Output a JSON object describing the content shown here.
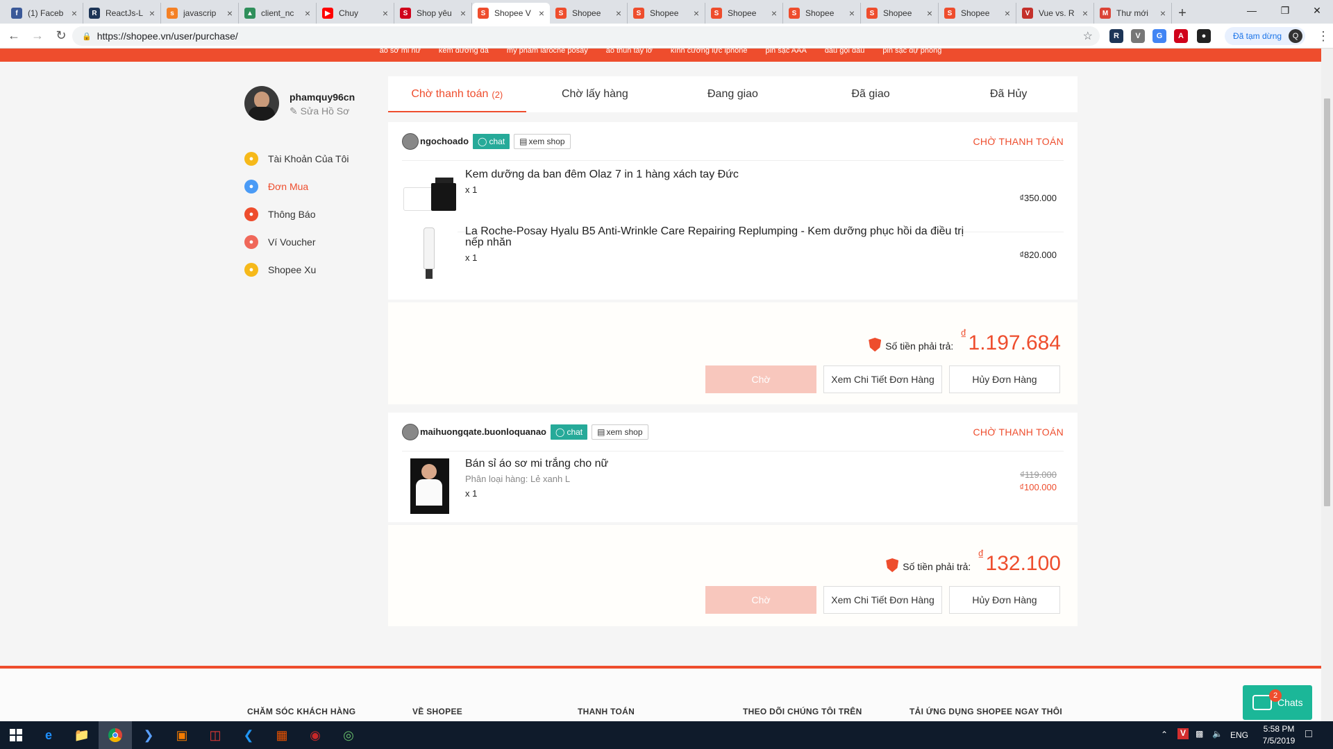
{
  "browser": {
    "tabs": [
      {
        "label": "(1) Faceb",
        "fav": "f",
        "color": "#3b5998"
      },
      {
        "label": "ReactJs-L",
        "fav": "R",
        "color": "#1d3557"
      },
      {
        "label": "javascrip",
        "fav": "s",
        "color": "#f48024"
      },
      {
        "label": "client_nc",
        "fav": "▲",
        "color": "#2f8f5b"
      },
      {
        "label": "Chuy",
        "fav": "▶",
        "color": "#ff0000"
      },
      {
        "label": "Shop yêu",
        "fav": "S",
        "color": "#d0021b"
      },
      {
        "label": "Shopee V",
        "fav": "S",
        "color": "#ee4d2d",
        "active": true
      },
      {
        "label": "Shopee",
        "fav": "S",
        "color": "#ee4d2d"
      },
      {
        "label": "Shopee",
        "fav": "S",
        "color": "#ee4d2d"
      },
      {
        "label": "Shopee",
        "fav": "S",
        "color": "#ee4d2d"
      },
      {
        "label": "Shopee",
        "fav": "S",
        "color": "#ee4d2d"
      },
      {
        "label": "Shopee",
        "fav": "S",
        "color": "#ee4d2d"
      },
      {
        "label": "Shopee",
        "fav": "S",
        "color": "#ee4d2d"
      },
      {
        "label": "Vue vs. R",
        "fav": "V",
        "color": "#c4302b"
      },
      {
        "label": "Thư mới",
        "fav": "M",
        "color": "#db4437"
      }
    ],
    "url": "https://shopee.vn/user/purchase/",
    "paused_label": "Đã tạm dừng",
    "profile_initial": "Q"
  },
  "top_keywords": [
    "áo sơ mi nữ",
    "kem dưỡng da",
    "mỹ phẩm laroche posay",
    "áo thun tay lỡ",
    "kính cường lực iphone",
    "pin sạc AAA",
    "dầu gội đầu",
    "pin sạc dự phòng"
  ],
  "user": {
    "username": "phamquy96cn",
    "edit_profile": "Sửa Hồ Sơ"
  },
  "sidebar": [
    {
      "label": "Tài Khoản Của Tôi",
      "color": "#f6b91a",
      "icon": "user-icon"
    },
    {
      "label": "Đơn Mua",
      "color": "#4a9bf6",
      "icon": "order-icon",
      "active": true
    },
    {
      "label": "Thông Báo",
      "color": "#ee4d2d",
      "icon": "bell-icon"
    },
    {
      "label": "Ví Voucher",
      "color": "#f0685a",
      "icon": "voucher-icon"
    },
    {
      "label": "Shopee Xu",
      "color": "#f6b91a",
      "icon": "coin-icon"
    }
  ],
  "order_tabs": [
    {
      "label": "Chờ thanh toán",
      "count": "(2)",
      "active": true
    },
    {
      "label": "Chờ lấy hàng"
    },
    {
      "label": "Đang giao"
    },
    {
      "label": "Đã giao"
    },
    {
      "label": "Đã Hủy"
    }
  ],
  "orders": [
    {
      "shop": "ngochoado",
      "chat": "chat",
      "view_shop": "xem shop",
      "status": "CHỜ THANH TOÁN",
      "items": [
        {
          "name": "Kem dưỡng da ban đêm Olaz 7 in 1 hàng xách tay Đức",
          "variant": "",
          "qty": "x 1",
          "old_price": "",
          "price": "₫350.000"
        },
        {
          "name": "La Roche-Posay Hyalu B5 Anti-Wrinkle Care Repairing Replumping - Kem dưỡng phục hồi da điều trị nếp nhăn",
          "variant": "",
          "qty": "x 1",
          "old_price": "",
          "price": "₫820.000"
        }
      ],
      "total_label": "Số tiền phải trả:",
      "total_currency": "₫",
      "total": "1.197.684",
      "btn_wait": "Chờ",
      "btn_detail": "Xem Chi Tiết Đơn Hàng",
      "btn_cancel": "Hủy Đơn Hàng"
    },
    {
      "shop": "maihuongqate.buonloquanao",
      "chat": "chat",
      "view_shop": "xem shop",
      "status": "CHỜ THANH TOÁN",
      "items": [
        {
          "name": "Bán sỉ áo sơ mi trắng cho nữ",
          "variant": "Phân loại hàng: Lẻ xanh L",
          "qty": "x 1",
          "old_price": "₫119.000",
          "price": "₫100.000"
        }
      ],
      "total_label": "Số tiền phải trả:",
      "total_currency": "₫",
      "total": "132.100",
      "btn_wait": "Chờ",
      "btn_detail": "Xem Chi Tiết Đơn Hàng",
      "btn_cancel": "Hủy Đơn Hàng"
    }
  ],
  "footer_headings": [
    "CHĂM SÓC KHÁCH HÀNG",
    "VỀ SHOPEE",
    "THANH TOÁN",
    "THEO DÕI CHÚNG TÔI TRÊN",
    "TẢI ỨNG DỤNG SHOPEE NGAY THÔI"
  ],
  "chat_widget": {
    "label": "Chats",
    "badge": "2"
  },
  "taskbar": {
    "lang": "ENG",
    "time": "5:58 PM",
    "date": "7/5/2019"
  }
}
